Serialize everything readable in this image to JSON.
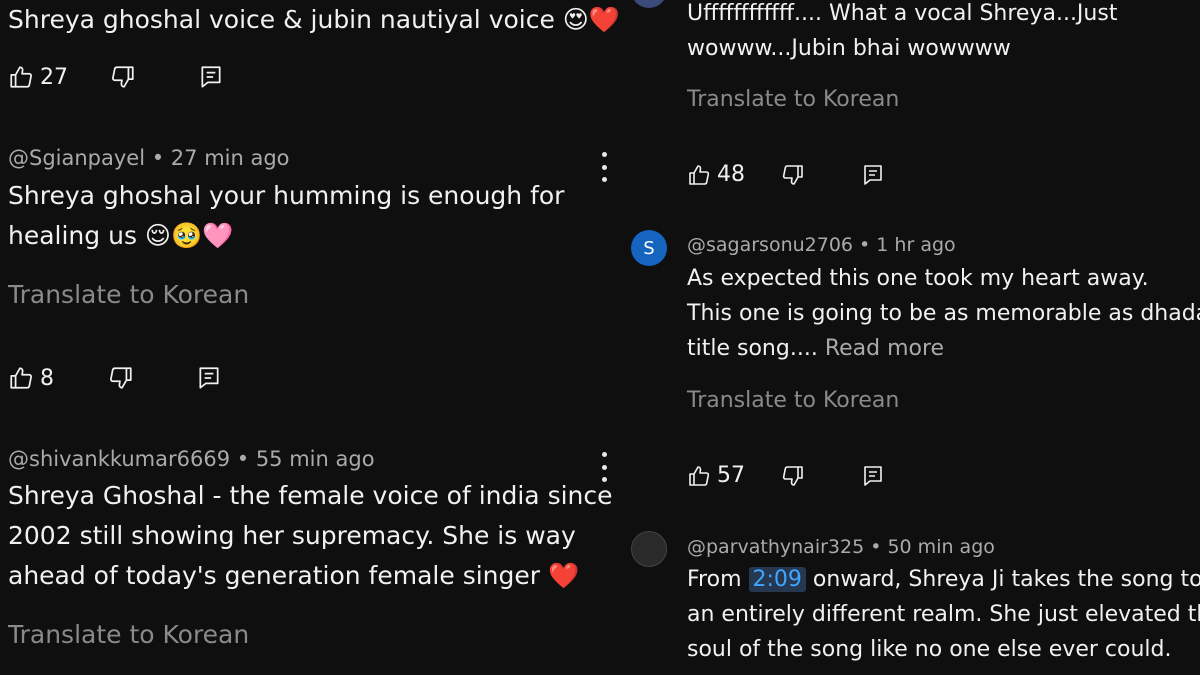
{
  "left": {
    "c1": {
      "text": "Shreya ghoshal voice & jubin nautiyal voice 😍❤️",
      "likes": "27"
    },
    "c2": {
      "meta": "@Sgianpayel • 27 min ago",
      "line1": "Shreya ghoshal your humming is enough for",
      "line2": "healing us 😌🥹🩷",
      "translate": "Translate to Korean",
      "likes": "8"
    },
    "c3": {
      "meta": "@shivankkumar6669 • 55 min ago",
      "line1": "Shreya Ghoshal - the female voice of india since",
      "line2": "2002 still showing her supremacy. She is way",
      "line3": "ahead of today's generation female singer ❤️",
      "translate": "Translate to Korean"
    }
  },
  "right": {
    "c1": {
      "line1": "Uffffffffffff.... What a vocal Shreya...Just",
      "line2": "wowww...Jubin bhai wowwww",
      "translate": "Translate to Korean",
      "likes": "48"
    },
    "c2": {
      "avatar_letter": "S",
      "meta": "@sagarsonu2706 • 1 hr ago",
      "line1": "As expected this one took my heart away.",
      "line2": "This one is going to be as memorable as dhadak",
      "line3": "title song....",
      "read_more": "Read more",
      "translate": "Translate to Korean",
      "likes": "57"
    },
    "c3": {
      "meta": "@parvathynair325 • 50 min ago",
      "line1_pre": "From",
      "timestamp": "2:09",
      "line1_post": "onward, Shreya Ji takes the song to",
      "line2": "an entirely different realm. She just elevated the",
      "line3": "soul of the song like no one else ever could."
    }
  },
  "icons": {
    "like": "thumb-up-icon",
    "dislike": "thumb-down-icon",
    "reply": "comment-reply-icon",
    "more": "more-vertical-icon"
  },
  "colors": {
    "background": "#0f0f0f",
    "text": "#f1f1f1",
    "meta": "#aaaaaa",
    "avatar_blue": "#1565c0",
    "timestamp_link": "#3ea6ff"
  }
}
